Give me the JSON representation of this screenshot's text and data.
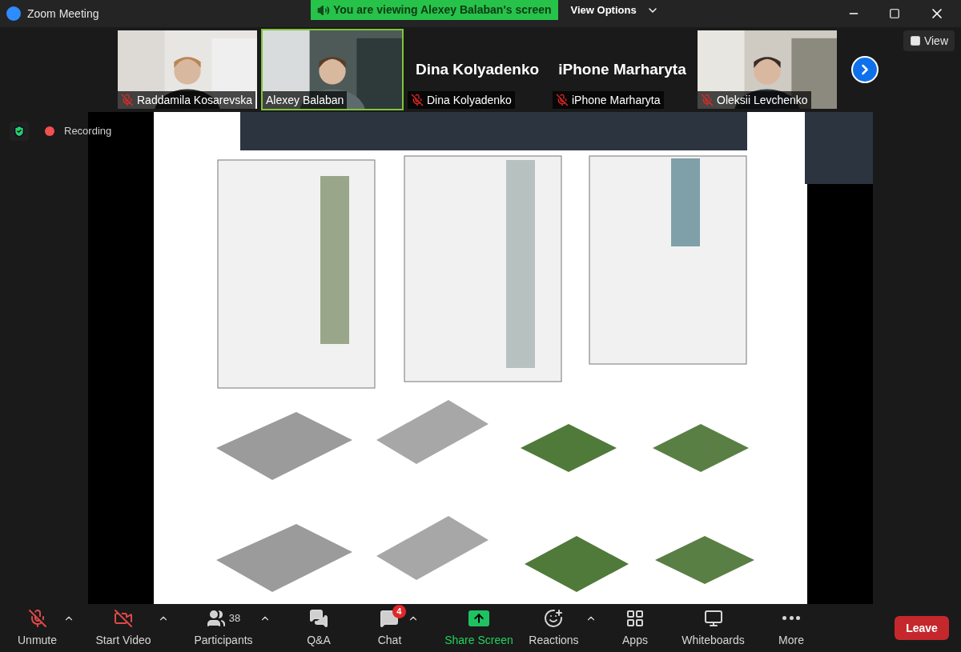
{
  "window": {
    "title": "Zoom Meeting"
  },
  "share_banner": {
    "text": "You are viewing Alexey Balaban's screen",
    "options": "View Options"
  },
  "participants": [
    {
      "name": "Raddamila Kosarevska",
      "muted": true,
      "video": true,
      "selected": false
    },
    {
      "name": "Alexey Balaban",
      "muted": false,
      "video": true,
      "selected": true
    },
    {
      "name": "Dina Kolyadenko",
      "muted": true,
      "video": false,
      "selected": false,
      "display_name": "Dina Kolyadenko"
    },
    {
      "name": "iPhone Marharyta",
      "muted": true,
      "video": false,
      "selected": false,
      "display_name": "iPhone Marharyta"
    },
    {
      "name": "Oleksii Levchenko",
      "muted": true,
      "video": true,
      "selected": false
    }
  ],
  "view_button": "View",
  "recording": "Recording",
  "toolbar": [
    {
      "kind": "mic",
      "label": "Unmute",
      "menu": true
    },
    {
      "kind": "video",
      "label": "Start Video",
      "menu": true
    },
    {
      "kind": "participants",
      "label": "Participants",
      "count": "38",
      "menu": true
    },
    {
      "kind": "qa",
      "label": "Q&A",
      "menu": false
    },
    {
      "kind": "chat",
      "label": "Chat",
      "badge": "4",
      "menu": true
    },
    {
      "kind": "share",
      "label": "Share Screen",
      "menu": false
    },
    {
      "kind": "reactions",
      "label": "Reactions",
      "menu": true
    },
    {
      "kind": "apps",
      "label": "Apps",
      "menu": false
    },
    {
      "kind": "whiteboards",
      "label": "Whiteboards",
      "menu": false
    },
    {
      "kind": "more",
      "label": "More",
      "menu": false
    }
  ],
  "leave_button": "Leave"
}
